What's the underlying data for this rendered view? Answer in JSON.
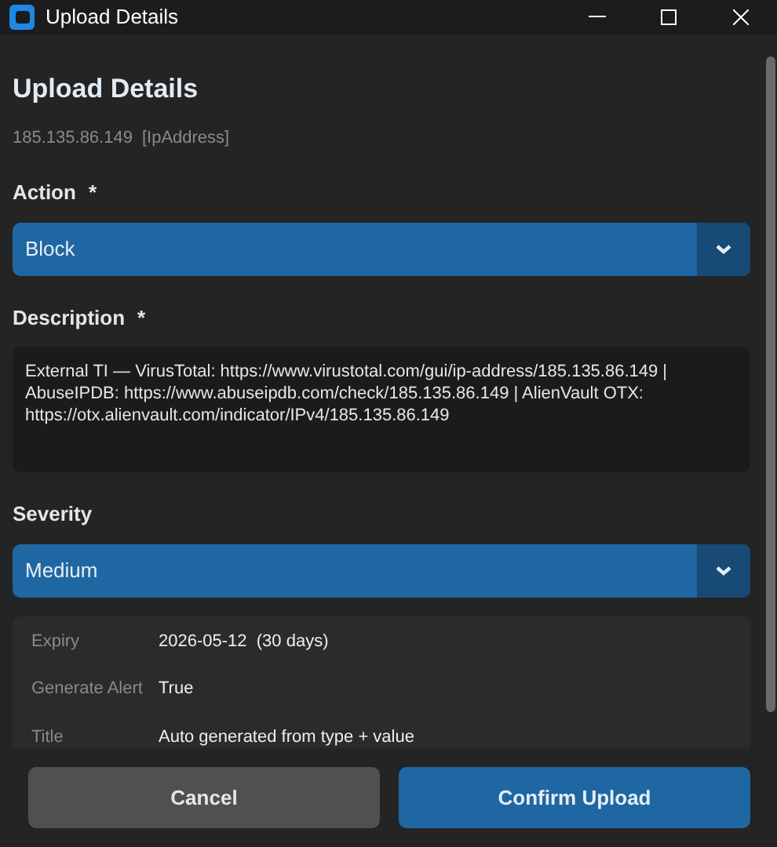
{
  "window": {
    "title": "Upload Details"
  },
  "heading": "Upload Details",
  "subtitle": {
    "value": "185.135.86.149",
    "type": "[IpAddress]"
  },
  "fields": [
    {
      "kind": "select",
      "label": "Action",
      "required_mark": "*",
      "value": "Block"
    },
    {
      "kind": "textarea",
      "label": "Description",
      "required_mark": "*",
      "value": "External TI — VirusTotal: https://www.virustotal.com/gui/ip-address/185.135.86.149 | AbuseIPDB: https://www.abuseipdb.com/check/185.135.86.149 | AlienVault OTX: https://otx.alienvault.com/indicator/IPv4/185.135.86.149"
    },
    {
      "kind": "select",
      "label": "Severity",
      "value": "Medium"
    }
  ],
  "details": [
    {
      "label": "Expiry",
      "value": "2026-05-12  (30 days)"
    },
    {
      "label": "Generate Alert",
      "value": "True"
    },
    {
      "label": "Title",
      "value": "Auto generated from type + value"
    }
  ],
  "buttons": [
    {
      "kind": "secondary",
      "label": "Cancel"
    },
    {
      "kind": "primary",
      "label": "Confirm Upload"
    }
  ]
}
